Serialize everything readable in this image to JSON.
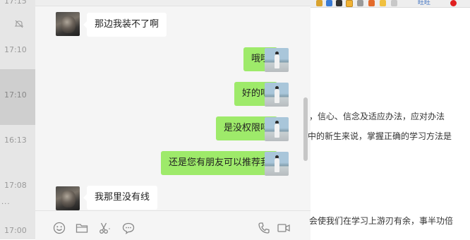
{
  "session_list": {
    "times": [
      "17:10",
      "17:10",
      "16:13",
      "17:08",
      "17:00"
    ],
    "top_partial_time": "17:15",
    "dots": "..."
  },
  "chat": {
    "messages": [
      {
        "side": "left",
        "text": "那边我装不了啊"
      },
      {
        "side": "right",
        "text": "哦哦"
      },
      {
        "side": "right",
        "text": "好的吧"
      },
      {
        "side": "right",
        "text": "是没权限吗"
      },
      {
        "side": "right",
        "text": "还是您有朋友可以推荐我"
      },
      {
        "side": "left",
        "text": "我那里没有线"
      }
    ],
    "toolbar": [
      "emoji-icon",
      "folder-icon",
      "scissors-icon",
      "chat-history-icon",
      "phone-icon",
      "video-icon"
    ]
  },
  "document": {
    "browser_link": "旺旺",
    "lines": [
      "，信心、信念及适应办法，应对办法",
      "中的新生来说，掌握正确的学习方法是",
      "会使我们在学习上游刃有余，事半功倍"
    ]
  }
}
